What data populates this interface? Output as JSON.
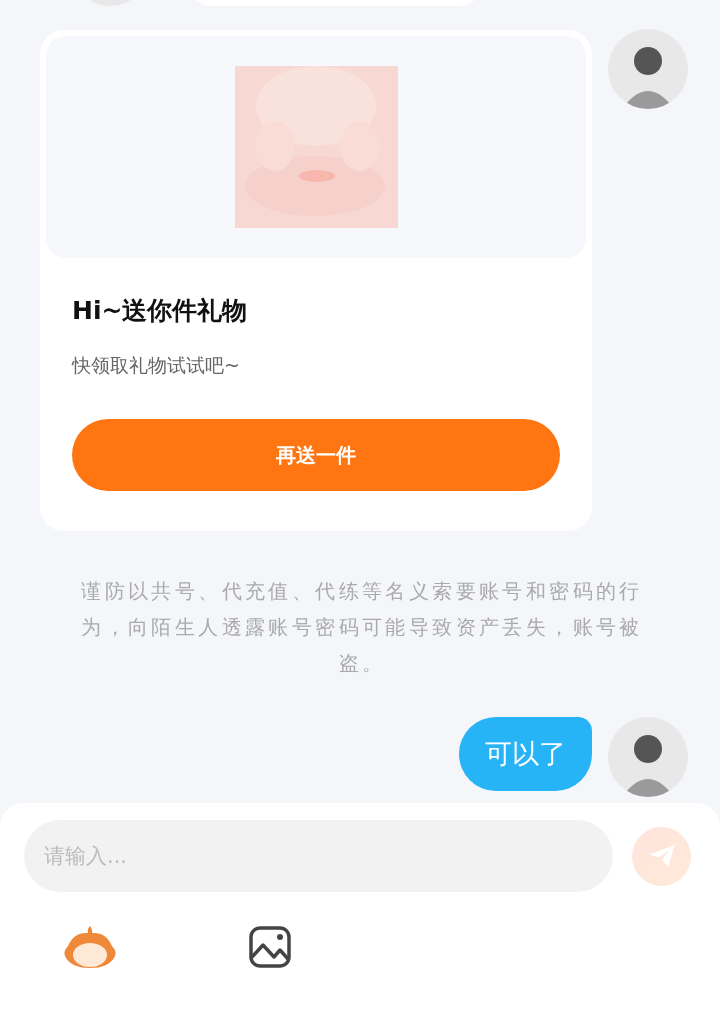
{
  "gift_card": {
    "title": "Hi~送你件礼物",
    "subtitle": "快领取礼物试试吧~",
    "button": "再送一件"
  },
  "notice": "谨防以共号、代充值、代练等名义索要账号和密码的行为，向陌生人透露账号密码可能导致资产丢失，账号被盗。",
  "messages": [
    {
      "text": "可以了"
    }
  ],
  "composer": {
    "placeholder": "请输入...",
    "send_disabled": true
  }
}
